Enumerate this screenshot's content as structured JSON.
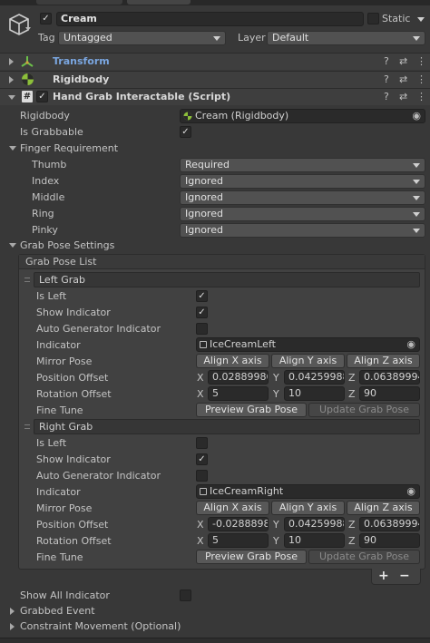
{
  "gameobject": {
    "name": "Cream",
    "static_label": "Static",
    "tag_label": "Tag",
    "tag_value": "Untagged",
    "layer_label": "Layer",
    "layer_value": "Default"
  },
  "components": [
    {
      "name": "Transform"
    },
    {
      "name": "Rigidbody"
    },
    {
      "name": "Hand Grab Interactable (Script)"
    }
  ],
  "script": {
    "rigidbody_label": "Rigidbody",
    "rigidbody_value": "Cream (Rigidbody)",
    "is_grabbable_label": "Is Grabbable",
    "finger_requirement_label": "Finger Requirement",
    "fingers": [
      {
        "label": "Thumb",
        "value": "Required"
      },
      {
        "label": "Index",
        "value": "Ignored"
      },
      {
        "label": "Middle",
        "value": "Ignored"
      },
      {
        "label": "Ring",
        "value": "Ignored"
      },
      {
        "label": "Pinky",
        "value": "Ignored"
      }
    ],
    "grab_pose_settings_label": "Grab Pose Settings",
    "grab_pose_list_label": "Grab Pose List",
    "grabs": [
      {
        "title": "Left Grab",
        "is_left_label": "Is Left",
        "is_left": true,
        "show_indicator_label": "Show Indicator",
        "show_indicator": true,
        "auto_gen_label": "Auto Generator Indicator",
        "auto_gen": false,
        "indicator_label": "Indicator",
        "indicator_value": "IceCreamLeft",
        "mirror_pose_label": "Mirror Pose",
        "align_x": "Align X axis",
        "align_y": "Align Y axis",
        "align_z": "Align Z axis",
        "position_offset_label": "Position Offset",
        "pos_x": "0.02889986",
        "pos_y": "0.04259988",
        "pos_z": "0.06389994",
        "rotation_offset_label": "Rotation Offset",
        "rot_x": "5",
        "rot_y": "10",
        "rot_z": "90",
        "fine_tune_label": "Fine Tune",
        "preview_btn": "Preview Grab Pose",
        "update_btn": "Update Grab Pose"
      },
      {
        "title": "Right Grab",
        "is_left_label": "Is Left",
        "is_left": false,
        "show_indicator_label": "Show Indicator",
        "show_indicator": true,
        "auto_gen_label": "Auto Generator Indicator",
        "auto_gen": false,
        "indicator_label": "Indicator",
        "indicator_value": "IceCreamRight",
        "mirror_pose_label": "Mirror Pose",
        "align_x": "Align X axis",
        "align_y": "Align Y axis",
        "align_z": "Align Z axis",
        "position_offset_label": "Position Offset",
        "pos_x": "-0.0288898",
        "pos_y": "0.04259988",
        "pos_z": "0.06389994",
        "rotation_offset_label": "Rotation Offset",
        "rot_x": "5",
        "rot_y": "10",
        "rot_z": "90",
        "fine_tune_label": "Fine Tune",
        "preview_btn": "Preview Grab Pose",
        "update_btn": "Update Grab Pose"
      }
    ],
    "axis_x": "X",
    "axis_y": "Y",
    "axis_z": "Z",
    "add_label": "+",
    "remove_label": "−",
    "show_all_indicator_label": "Show All Indicator",
    "grabbed_event_label": "Grabbed Event",
    "constraint_movement_label": "Constraint Movement (Optional)"
  },
  "icons": {
    "help": "?",
    "presets": "⇄",
    "menu": "⋮",
    "check": "✓",
    "target": "◉"
  }
}
